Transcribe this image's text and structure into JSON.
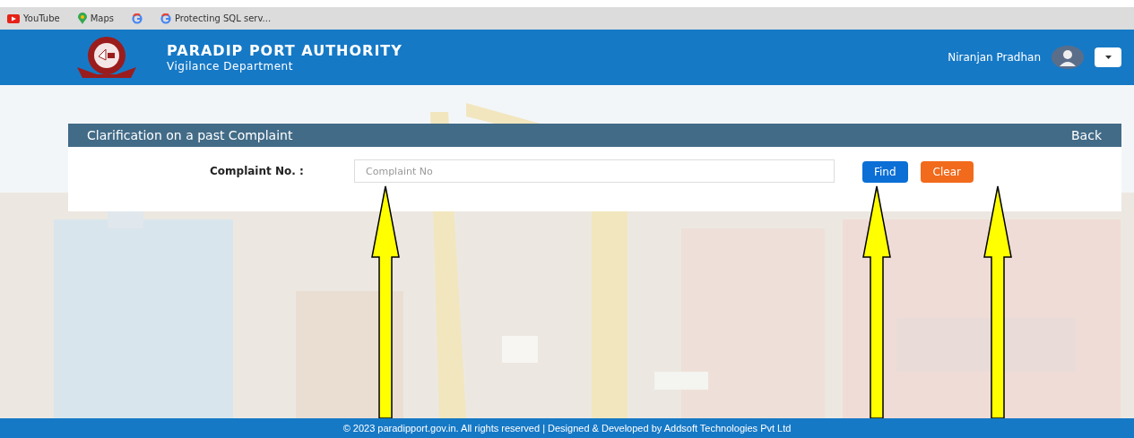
{
  "bookmarks": [
    {
      "kind": "youtube",
      "label": "YouTube"
    },
    {
      "kind": "maps",
      "label": "Maps"
    },
    {
      "kind": "google"
    },
    {
      "kind": "google",
      "label": "Protecting SQL serv..."
    }
  ],
  "header": {
    "title": "PARADIP PORT AUTHORITY",
    "subtitle": "Vigilance Department",
    "user": "Niranjan Pradhan"
  },
  "card": {
    "title": "Clarification on a past Complaint",
    "back": "Back",
    "field": {
      "label": "Complaint No. :",
      "placeholder": "Complaint No"
    },
    "buttons": [
      {
        "kind": "primary",
        "label": "Find"
      },
      {
        "kind": "danger",
        "label": "Clear"
      }
    ]
  },
  "footer": "© 2023 paradipport.gov.in. All rights reserved | Designed & Developed by Addsoft Technologies Pvt Ltd"
}
